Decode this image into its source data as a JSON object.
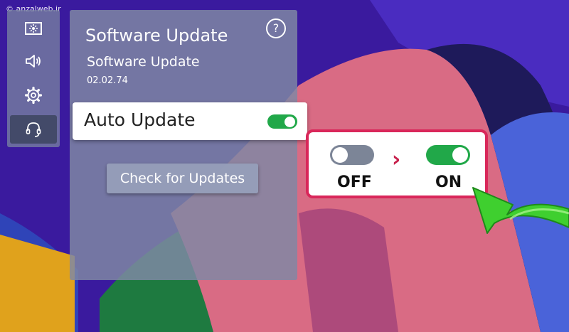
{
  "watermark": "© anzalweb.ir",
  "side_rail": {
    "items": [
      {
        "icon": "picture-icon"
      },
      {
        "icon": "speaker-icon"
      },
      {
        "icon": "gear-icon"
      },
      {
        "icon": "headset-icon",
        "active": true
      }
    ]
  },
  "panel": {
    "title": "Software Update",
    "help_glyph": "?",
    "section_title": "Software Update",
    "version": "02.02.74",
    "auto_update": {
      "label": "Auto Update",
      "enabled": true
    },
    "check_button": "Check for Updates"
  },
  "callout": {
    "from_label": "OFF",
    "to_label": "ON",
    "arrow_glyph": "›"
  },
  "colors": {
    "toggle_on": "#21a849",
    "toggle_off": "#7c8597",
    "callout_border": "#d9275a",
    "pointer_arrow": "#3fcf2f"
  }
}
